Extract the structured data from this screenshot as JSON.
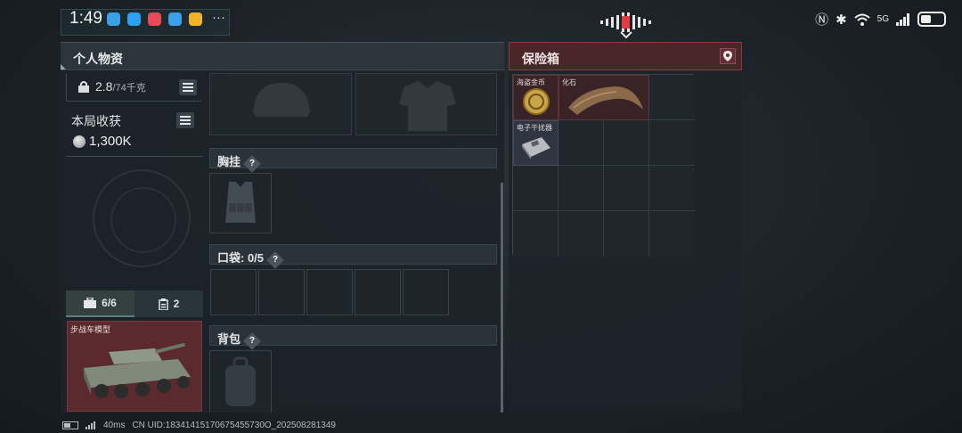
{
  "status_bar": {
    "time": "1:49",
    "overflow_label": "···",
    "network_label": "5G"
  },
  "personal": {
    "title": "个人物资",
    "weight_value": "2.8",
    "weight_max": "/74千克",
    "loot_title": "本局收获",
    "loot_value": "1,300K",
    "tabs": [
      {
        "label": "6/6"
      },
      {
        "label": "2"
      }
    ],
    "featured_item": "步战车模型",
    "sections": {
      "chest": "胸挂",
      "pocket": "口袋: 0/5",
      "backpack": "背包"
    },
    "help_glyph": "?"
  },
  "safe_box": {
    "title": "保险箱",
    "items": [
      {
        "label": "海盗金币"
      },
      {
        "label": "化石"
      },
      {
        "label": "电子干扰器"
      }
    ]
  },
  "footer": {
    "ping": "40ms",
    "uid": "CN UID:18341415170675455730O_202508281349"
  }
}
